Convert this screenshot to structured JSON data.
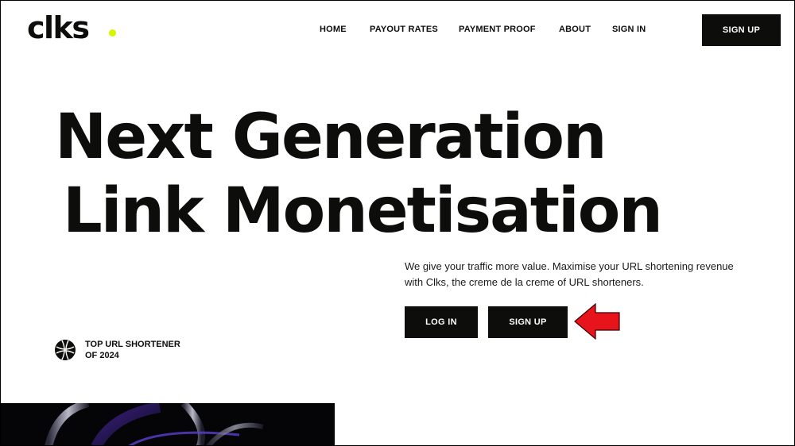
{
  "brand": {
    "name": "clks",
    "dot_color": "#d5f500"
  },
  "nav": {
    "items": [
      {
        "label": "HOME"
      },
      {
        "label": "PAYOUT RATES"
      },
      {
        "label": "PAYMENT PROOF"
      },
      {
        "label": "ABOUT"
      },
      {
        "label": "SIGN IN"
      }
    ],
    "signup_label": "SIGN UP"
  },
  "hero": {
    "line1": "Next Generation",
    "line2": "Link Monetisation",
    "description_line1": "We give your traffic more value. Maximise your URL shortening revenue",
    "description_line2": "with Clks, the creme de la creme of URL shorteners.",
    "login_label": "LOG IN",
    "signup_label": "SIGN UP"
  },
  "badge": {
    "icon": "globe-icon",
    "line1": "TOP URL SHORTENER",
    "line2": "OF 2024"
  },
  "annotation": {
    "icon": "red-arrow-icon",
    "color": "#e8141b"
  },
  "colors": {
    "dark": "#0d0d0b",
    "accent": "#d5f500"
  }
}
